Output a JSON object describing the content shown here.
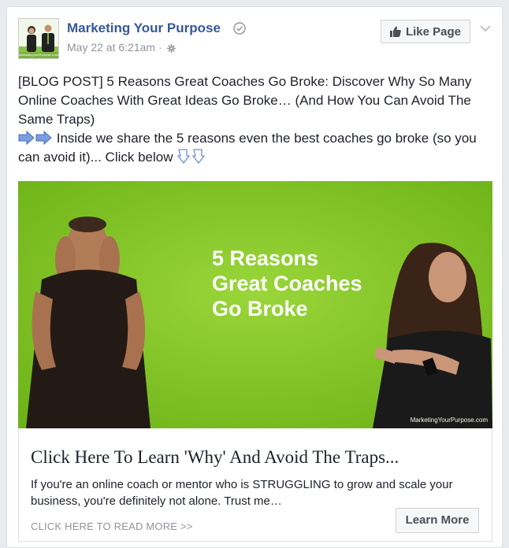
{
  "post": {
    "page_name": "Marketing Your Purpose",
    "timestamp": "May 22 at 6:21am",
    "separator": "·",
    "like_button": "Like Page",
    "text_line1": "[BLOG POST] 5 Reasons Great Coaches Go Broke: Discover Why So Many Online Coaches With Great Ideas Go Broke… (And How You Can Avoid The Same Traps)",
    "text_line2": "Inside we share the 5 reasons even the best coaches go broke (so you can avoid it)... Click below",
    "avatar_text": "MarketingYourPurpose.Com"
  },
  "image": {
    "title": "5 Reasons\nGreat Coaches\nGo Broke",
    "watermark": "MarketingYourPurpose.com"
  },
  "link": {
    "title": "Click Here To Learn 'Why' And Avoid The Traps...",
    "description": "If you're an online coach or mentor who is STRUGGLING to grow and scale your business, you're definitely not alone. Trust me…",
    "caption": "CLICK HERE TO READ MORE >>",
    "cta": "Learn More"
  },
  "colors": {
    "link_blue": "#365899",
    "image_green": "#7cc21f",
    "meta_gray": "#90949c"
  },
  "icons": [
    "verified-icon",
    "gear-icon",
    "thumbs-up-icon",
    "chevron-down-icon",
    "arrow-right-icon",
    "pointing-down-icon"
  ]
}
